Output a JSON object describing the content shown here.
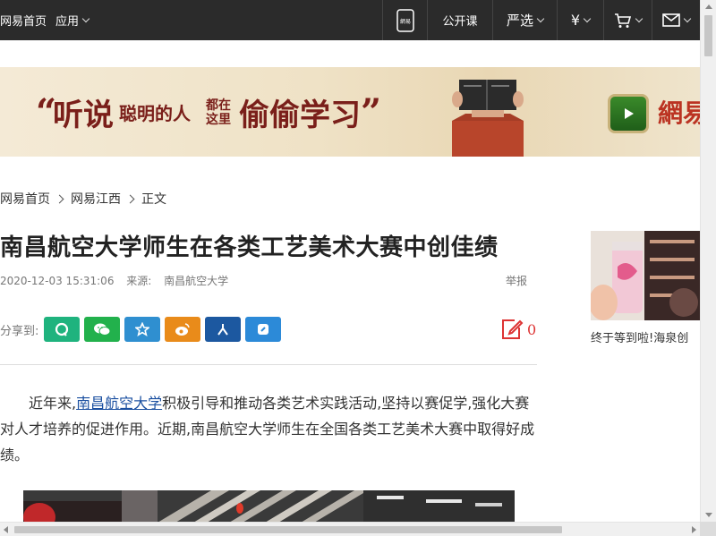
{
  "topbar": {
    "home": "网易首页",
    "app": "应用",
    "mobile_icon_text": "網易",
    "open_course": "公开课",
    "yanxuan": "严选",
    "money_symbol": "¥"
  },
  "banner": {
    "open_quote": "“",
    "close_quote": "”",
    "word_1": "听说",
    "word_2": "聪明的人",
    "tiny_1": "都在",
    "tiny_2": "这里",
    "word_3": "偷偷学习",
    "brand": "網易"
  },
  "breadcrumb": {
    "items": [
      "网易首页",
      "网易江西",
      "正文"
    ]
  },
  "article": {
    "title": "南昌航空大学师生在各类工艺美术大赛中创佳绩",
    "datetime": "2020-12-03 15:31:06",
    "source_label": "来源:",
    "source": "南昌航空大学",
    "report": "举报",
    "share_label": "分享到:",
    "comment_count": "0",
    "para_prefix": "近年来,",
    "para_link": "南昌航空大学",
    "para_rest": "积极引导和推动各类艺术实践活动,坚持以赛促学,强化大赛对人才培养的促进作用。近期,南昌航空大学师生在全国各类工艺美术大赛中取得好成绩。"
  },
  "side": {
    "caption": "终于等到啦!海泉创"
  },
  "colors": {
    "topbar_bg": "#2b2b2b",
    "title_color": "#222222",
    "link_color": "#1a4fa0",
    "accent_red": "#d12222"
  }
}
